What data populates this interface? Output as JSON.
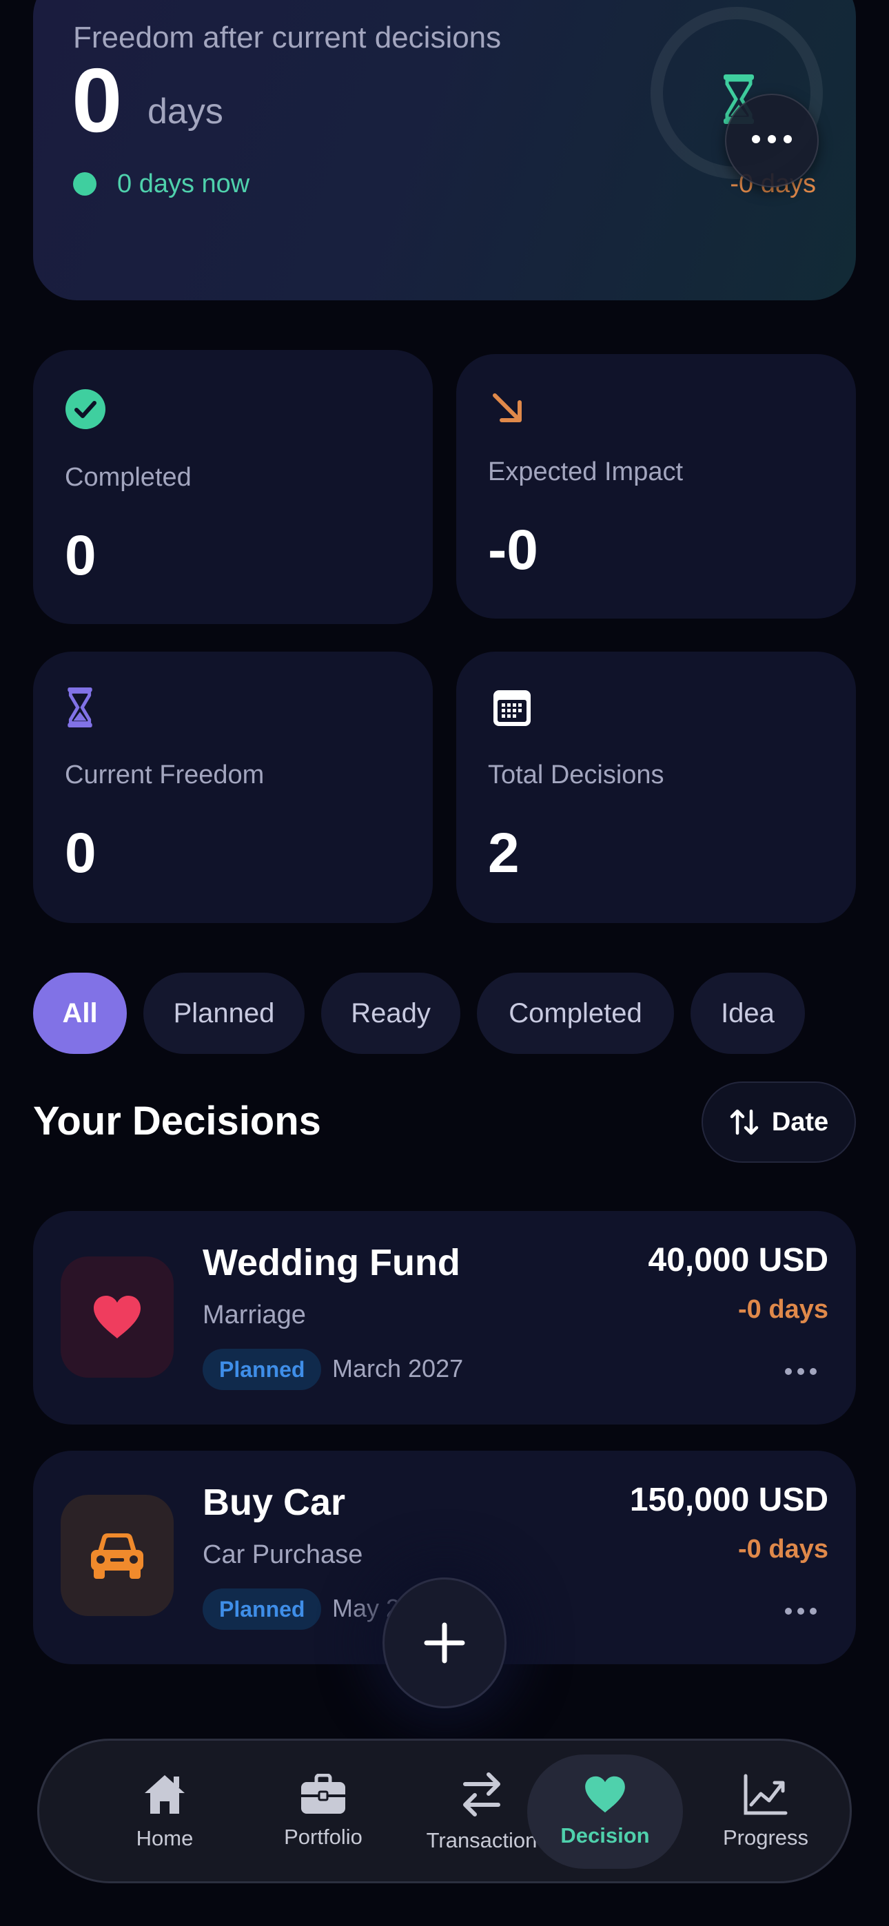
{
  "hero": {
    "label": "Freedom after current decisions",
    "value": "0",
    "unit": "days",
    "now_text": "0 days now",
    "delta_text": "-0 days",
    "accent": "#3fcf9f",
    "icons": [
      "hourglass-icon",
      "more-horizontal-icon"
    ]
  },
  "stats": [
    {
      "label": "Completed",
      "value": "0",
      "icon": "check-circle-icon",
      "color": "#3fcf9f"
    },
    {
      "label": "Expected Impact",
      "value": "-0",
      "icon": "arrow-down-right-icon",
      "color": "#e0894a"
    },
    {
      "label": "Current Freedom",
      "value": "0",
      "icon": "hourglass-icon",
      "color": "#8172e6"
    },
    {
      "label": "Total Decisions",
      "value": "2",
      "icon": "calendar-icon",
      "color": "#ffffff"
    }
  ],
  "filters": {
    "items": [
      "All",
      "Planned",
      "Ready",
      "Completed",
      "Idea"
    ],
    "active": "All",
    "active_color": "#8172e6"
  },
  "section": {
    "title": "Your Decisions",
    "sort_label": "Date",
    "sort_icon": "sort-arrows-icon"
  },
  "decisions": [
    {
      "title": "Wedding Fund",
      "category": "Marriage",
      "status": "Planned",
      "date": "March 2027",
      "amount": "40,000 USD",
      "impact": "-0 days",
      "icon": "heart-icon",
      "icon_color": "#ef3d5e"
    },
    {
      "title": "Buy Car",
      "category": "Car Purchase",
      "status": "Planned",
      "date": "May 2",
      "amount": "150,000 USD",
      "impact": "-0 days",
      "icon": "car-icon",
      "icon_color": "#f08a2c"
    }
  ],
  "fab": {
    "icon": "plus-icon"
  },
  "tabs": [
    {
      "label": "Home",
      "icon": "home-icon"
    },
    {
      "label": "Portfolio",
      "icon": "briefcase-icon"
    },
    {
      "label": "Transaction",
      "icon": "swap-arrows-icon"
    },
    {
      "label": "Decision",
      "icon": "heart-icon",
      "active": true
    },
    {
      "label": "Progress",
      "icon": "chart-line-icon"
    }
  ]
}
